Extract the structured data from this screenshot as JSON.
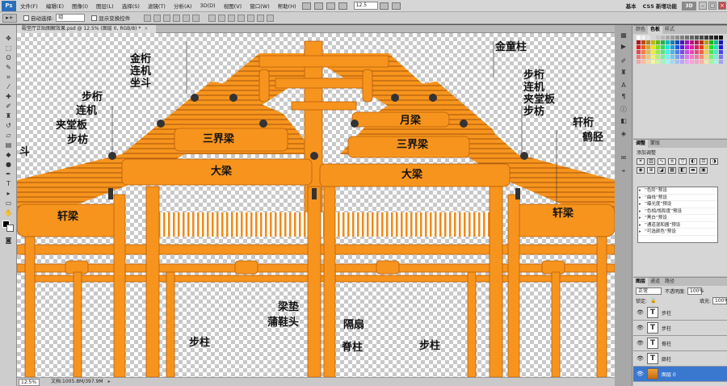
{
  "app": {
    "logo": "Ps"
  },
  "menu": [
    "文件(F)",
    "编辑(E)",
    "图像(I)",
    "图层(L)",
    "选择(S)",
    "滤镜(T)",
    "分析(A)",
    "3D(D)",
    "视图(V)",
    "窗口(W)",
    "帮助(H)"
  ],
  "menubar_zoom": "12.5",
  "workspaces": [
    "基本",
    "CS5 新增功能"
  ],
  "ps3d_label": "3D",
  "window_buttons": {
    "min": "–",
    "max": "□",
    "close": "×"
  },
  "options": {
    "tool_icon": "▸+",
    "auto_select_label": "自动选择:",
    "auto_select_value": "组",
    "show_transform_label": "显示变换控件"
  },
  "document": {
    "tab_title": "殿堂厅正贴图解效果.psd @ 12.5% (图层 0, RGB/8) *",
    "close": "×"
  },
  "status": {
    "zoom": "12.5%",
    "doc_size": "文档:1005.8M/397.9M",
    "arrow": "▸"
  },
  "labels": {
    "jin_heng": "金桁",
    "lian_ji_1": "连机",
    "zuo_dou": "坐斗",
    "bu_heng_l": "步桁",
    "lian_ji_l": "连机",
    "jia_tang_ban_l": "夹堂板",
    "bu_fang_l": "步枋",
    "dou": "斗",
    "san_jie_liang_l": "三界梁",
    "da_liang_l": "大梁",
    "xuan_liang_l": "轩梁",
    "jin_tong_zhu": "金童柱",
    "yue_liang": "月梁",
    "san_jie_liang_r": "三界梁",
    "da_liang_r": "大梁",
    "bu_heng_r": "步桁",
    "lian_ji_r": "连机",
    "jia_tang_ban_r": "夹堂板",
    "bu_fang_r": "步枋",
    "xuan_heng": "轩桁",
    "he_jing": "鹤胫",
    "xuan_liang_r": "轩梁",
    "liang_dian": "梁垫",
    "pu_xie_tou": "蒲鞋头",
    "ge_shan": "隔扇",
    "bu_zhu_l": "步柱",
    "ji_zhu": "脊柱",
    "bu_zhu_r": "步柱"
  },
  "panels": {
    "swatch_tabs": [
      "颜色",
      "色板",
      "样式"
    ],
    "adjust_tabs": [
      "调整",
      "蒙版"
    ],
    "adjust_title": "添加调整",
    "presets": [
      "“色阶”预设",
      "“曲线”预设",
      "“曝光度”预设",
      "“色相/饱和度”预设",
      "“黑白”预设",
      "“通道混和器”预设",
      "“可选颜色”预设"
    ],
    "layer_tabs": [
      "图层",
      "通道",
      "路径"
    ],
    "blend_mode": "正常",
    "opacity_label": "不透明度:",
    "opacity_value": "100%",
    "lock_label": "锁定:",
    "fill_label": "填充:",
    "fill_value": "100%",
    "layers": [
      {
        "name": "步柱",
        "thumb": "T"
      },
      {
        "name": "步柱",
        "thumb": "T"
      },
      {
        "name": "脊柱",
        "thumb": "T"
      },
      {
        "name": "廊柱",
        "thumb": "T"
      },
      {
        "name": "图层 0",
        "thumb": ""
      }
    ]
  },
  "colors": {
    "timber": "#f7941d",
    "timber_dark": "#d9730f",
    "timber_shadow": "#b85f0c",
    "joint": "#333333",
    "selection": "#3a78d0"
  }
}
